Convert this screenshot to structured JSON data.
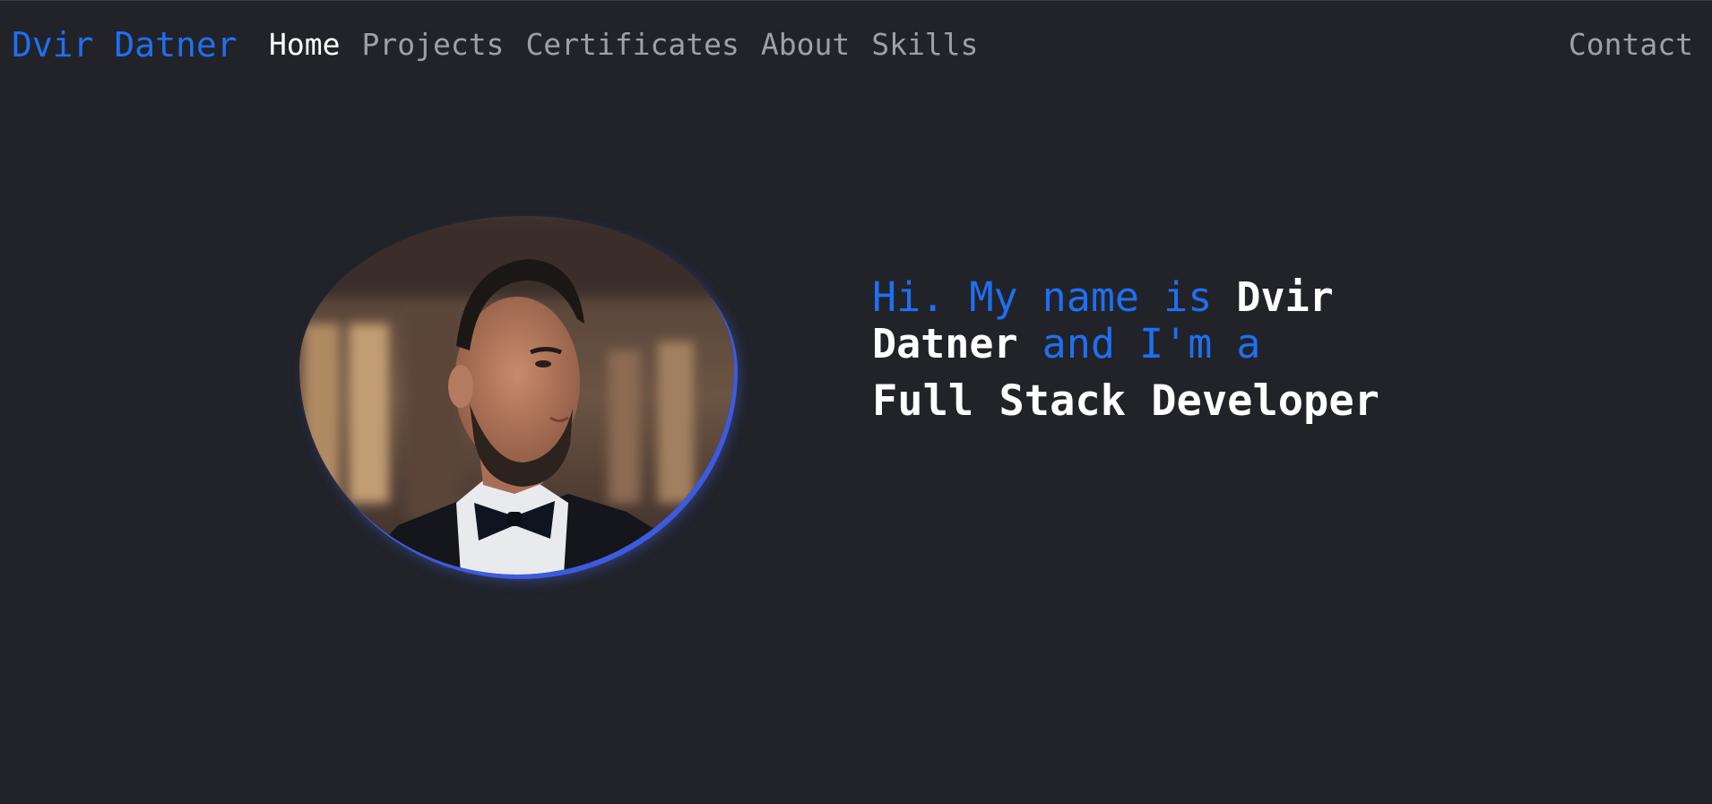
{
  "nav": {
    "brand": "Dvir Datner",
    "links": [
      "Home",
      "Projects",
      "Certificates",
      "About",
      "Skills"
    ],
    "active": "Home",
    "contact": "Contact"
  },
  "hero": {
    "intro_prefix": "Hi. My name is ",
    "name_first": "Dvir",
    "name_last": "Datner",
    "intro_suffix": " and I'm a",
    "role": "Full Stack Developer"
  },
  "colors": {
    "background": "#212329",
    "accent": "#1f6ff2",
    "nav_text": "#9da1a6",
    "active_text": "#ffffff",
    "portrait_border": "#3d5bdf"
  },
  "portrait": {
    "alt": "portrait photo"
  }
}
